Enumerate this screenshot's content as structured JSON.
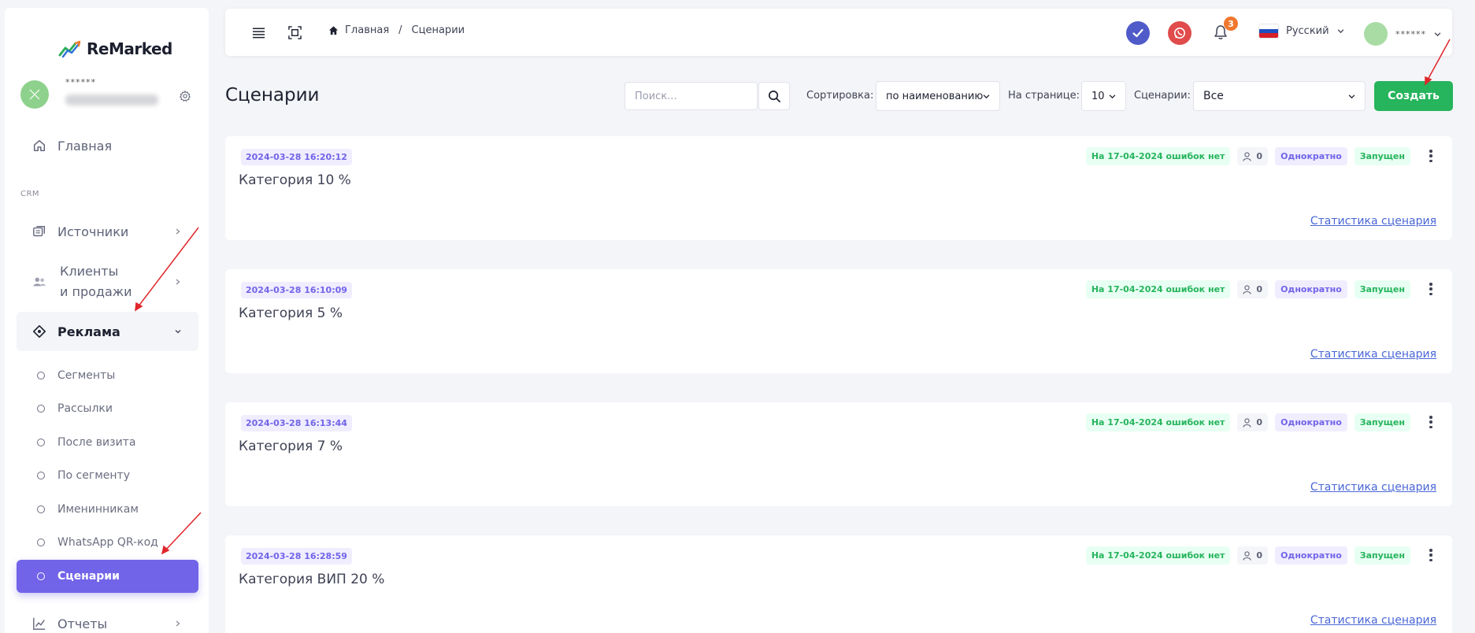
{
  "sidebar": {
    "logo_text": "ReMarked",
    "profile_name": "******",
    "nav": {
      "home": "Главная",
      "section_crm": "CRM",
      "sources": "Источники",
      "clients_line1": "Клиенты",
      "clients_line2": "и продажи",
      "ads": "Реклама",
      "reports": "Отчеты"
    },
    "submenu": [
      {
        "label": "Сегменты",
        "active": false
      },
      {
        "label": "Рассылки",
        "active": false
      },
      {
        "label": "После визита",
        "active": false
      },
      {
        "label": "По сегменту",
        "active": false
      },
      {
        "label": "Именинникам",
        "active": false
      },
      {
        "label": "WhatsApp QR-код",
        "active": false
      },
      {
        "label": "Сценарии",
        "active": true
      }
    ]
  },
  "topbar": {
    "breadcrumb_home": "Главная",
    "breadcrumb_sep": "/",
    "breadcrumb_current": "Сценарии",
    "notifications_count": "3",
    "language": "Русский",
    "user_name": "******"
  },
  "page": {
    "title": "Сценарии",
    "search_placeholder": "Поиск...",
    "sort_label": "Сортировка:",
    "sort_value": "по наименованию",
    "per_page_label": "На странице:",
    "per_page_value": "10",
    "scenarios_label": "Сценарии:",
    "scenarios_value": "Все",
    "create_button": "Создать"
  },
  "cards": [
    {
      "date": "2024-03-28 16:20:12",
      "title": "Категория 10 %",
      "errors": "На 17-04-2024 ошибок нет",
      "users": "0",
      "frequency": "Однократно",
      "status": "Запущен",
      "link": "Статистика сценария"
    },
    {
      "date": "2024-03-28 16:10:09",
      "title": "Категория 5 %",
      "errors": "На 17-04-2024 ошибок нет",
      "users": "0",
      "frequency": "Однократно",
      "status": "Запущен",
      "link": "Статистика сценария"
    },
    {
      "date": "2024-03-28 16:13:44",
      "title": "Категория 7 %",
      "errors": "На 17-04-2024 ошибок нет",
      "users": "0",
      "frequency": "Однократно",
      "status": "Запущен",
      "link": "Статистика сценария"
    },
    {
      "date": "2024-03-28 16:28:59",
      "title": "Категория ВИП 20 %",
      "errors": "На 17-04-2024 ошибок нет",
      "users": "0",
      "frequency": "Однократно",
      "status": "Запущен",
      "link": "Статистика сценария"
    }
  ],
  "colors": {
    "accent": "#7164e8",
    "create_green": "#26b45c",
    "annotation_arrow": "#e0262b"
  }
}
